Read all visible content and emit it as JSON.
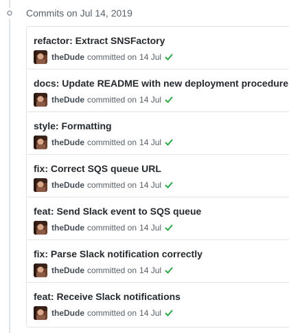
{
  "group": {
    "title": "Commits on Jul 14, 2019",
    "icon": "git-commit-icon"
  },
  "commits": [
    {
      "title": "refactor: Extract SNSFactory",
      "author": "theDude",
      "committed_text": "committed on",
      "date": "14 Jul",
      "status": "success"
    },
    {
      "title": "docs: Update README with new deployment procedure",
      "author": "theDude",
      "committed_text": "committed on",
      "date": "14 Jul",
      "status": "success"
    },
    {
      "title": "style: Formatting",
      "author": "theDude",
      "committed_text": "committed on",
      "date": "14 Jul",
      "status": "success"
    },
    {
      "title": "fix: Correct SQS queue URL",
      "author": "theDude",
      "committed_text": "committed on",
      "date": "14 Jul",
      "status": "success"
    },
    {
      "title": "feat: Send Slack event to SQS queue",
      "author": "theDude",
      "committed_text": "committed on",
      "date": "14 Jul",
      "status": "success"
    },
    {
      "title": "fix: Parse Slack notification correctly",
      "author": "theDude",
      "committed_text": "committed on",
      "date": "14 Jul",
      "status": "success"
    },
    {
      "title": "feat: Receive Slack notifications",
      "author": "theDude",
      "committed_text": "committed on",
      "date": "14 Jul",
      "status": "success"
    }
  ],
  "colors": {
    "success": "#28a745",
    "title": "#24292e",
    "muted": "#586069",
    "border": "#e1e4e8"
  }
}
